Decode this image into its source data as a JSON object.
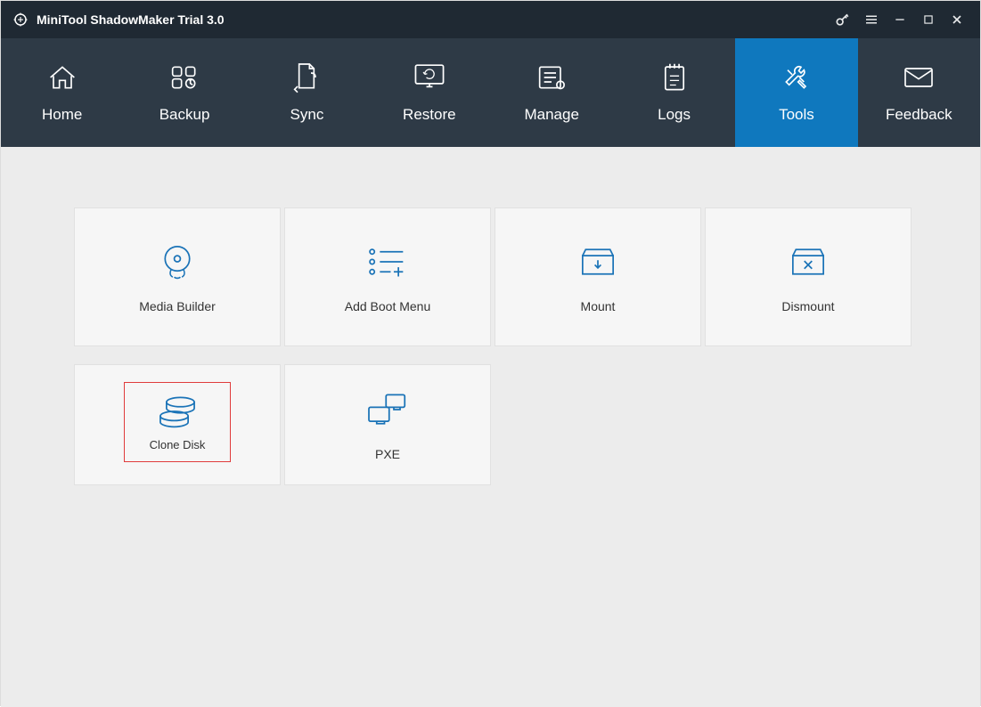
{
  "titlebar": {
    "app_title": "MiniTool ShadowMaker Trial 3.0"
  },
  "nav": {
    "items": [
      {
        "label": "Home"
      },
      {
        "label": "Backup"
      },
      {
        "label": "Sync"
      },
      {
        "label": "Restore"
      },
      {
        "label": "Manage"
      },
      {
        "label": "Logs"
      },
      {
        "label": "Tools"
      },
      {
        "label": "Feedback"
      }
    ]
  },
  "tools": {
    "row1": [
      {
        "label": "Media Builder"
      },
      {
        "label": "Add Boot Menu"
      },
      {
        "label": "Mount"
      },
      {
        "label": "Dismount"
      }
    ],
    "row2": [
      {
        "label": "Clone Disk"
      },
      {
        "label": "PXE"
      }
    ]
  },
  "colors": {
    "accent": "#0f78be",
    "icon": "#1a73b7",
    "highlight": "#e03b3b"
  }
}
